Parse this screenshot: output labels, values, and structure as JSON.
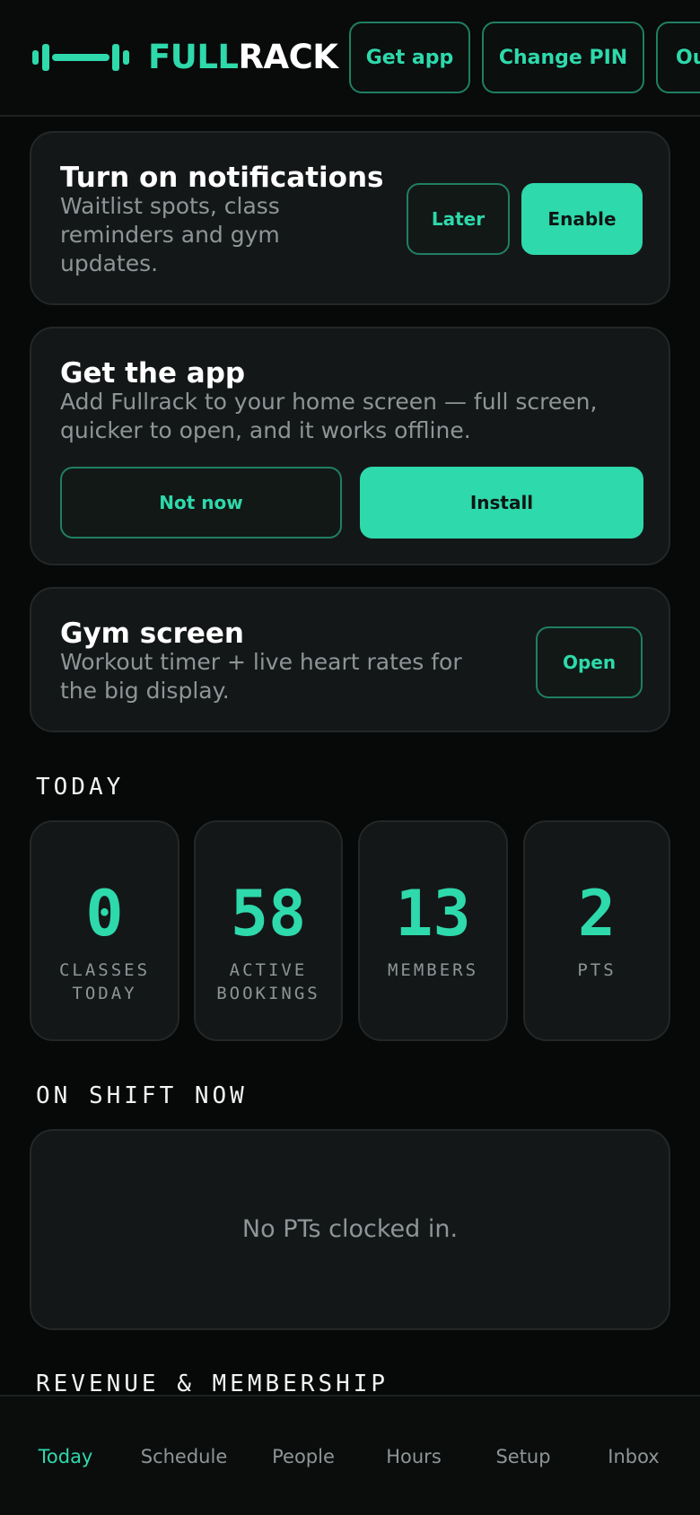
{
  "header": {
    "brand_part1": "FULL",
    "brand_part2": "RACK",
    "get_app_label": "Get app",
    "change_pin_label": "Change PIN",
    "out_label": "Out"
  },
  "notifications_card": {
    "title": "Turn on notifications",
    "text": "Waitlist spots, class reminders and gym updates.",
    "later_label": "Later",
    "enable_label": "Enable"
  },
  "app_card": {
    "title": "Get the app",
    "text": "Add Fullrack to your home screen — full screen, quicker to open, and it works offline.",
    "not_now_label": "Not now",
    "install_label": "Install"
  },
  "gym_screen_card": {
    "title": "Gym screen",
    "text": "Workout timer + live heart rates for the big display.",
    "open_label": "Open"
  },
  "today": {
    "section_label": "TODAY",
    "stats": [
      {
        "value": "0",
        "label": "CLASSES TODAY"
      },
      {
        "value": "58",
        "label": "ACTIVE BOOKINGS"
      },
      {
        "value": "13",
        "label": "MEMBERS"
      },
      {
        "value": "2",
        "label": "PTS"
      }
    ]
  },
  "on_shift": {
    "section_label": "ON SHIFT NOW",
    "empty_text": "No PTs clocked in."
  },
  "revenue": {
    "section_label": "REVENUE & MEMBERSHIP"
  },
  "bottom_nav": {
    "items": [
      {
        "label": "Today",
        "active": true
      },
      {
        "label": "Schedule"
      },
      {
        "label": "People"
      },
      {
        "label": "Hours"
      },
      {
        "label": "Setup"
      },
      {
        "label": "Inbox"
      }
    ]
  },
  "colors": {
    "accent": "#2ed9ab",
    "background": "#070808",
    "card": "#141718",
    "muted_text": "#8e9596"
  },
  "icons": {
    "logo": "barbell-icon"
  }
}
